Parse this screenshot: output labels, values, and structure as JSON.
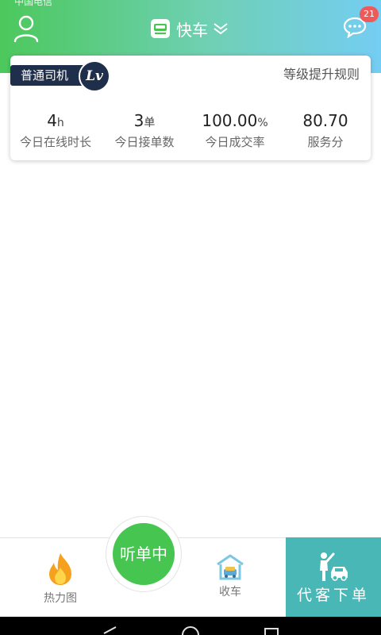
{
  "header": {
    "status_text": "中国电信",
    "title": "快车",
    "badge_count": "21",
    "colors": {
      "gradient_start": "#4cc85c",
      "gradient_end": "#74cdf3"
    },
    "icons": [
      "user-icon",
      "car-icon",
      "chevron-down-icon",
      "chat-icon"
    ]
  },
  "card": {
    "level_tag": "普通司机",
    "lv_badge": "Lv",
    "rules_link": "等级提升规则",
    "stats": [
      {
        "value": "4",
        "unit": "h",
        "label": "今日在线时长"
      },
      {
        "value": "3",
        "unit": "单",
        "label": "今日接单数"
      },
      {
        "value": "100.00",
        "unit": "%",
        "label": "今日成交率"
      },
      {
        "value": "80.70",
        "unit": "",
        "label": "服务分"
      }
    ]
  },
  "bottom": {
    "heatmap_label": "热力图",
    "listen_label": "听单中",
    "park_label": "收车",
    "order_label": "代客下单",
    "colors": {
      "listen": "#46c651",
      "order": "#49b7b6"
    },
    "icons": [
      "fire-icon",
      "garage-icon",
      "person-car-icon"
    ]
  }
}
